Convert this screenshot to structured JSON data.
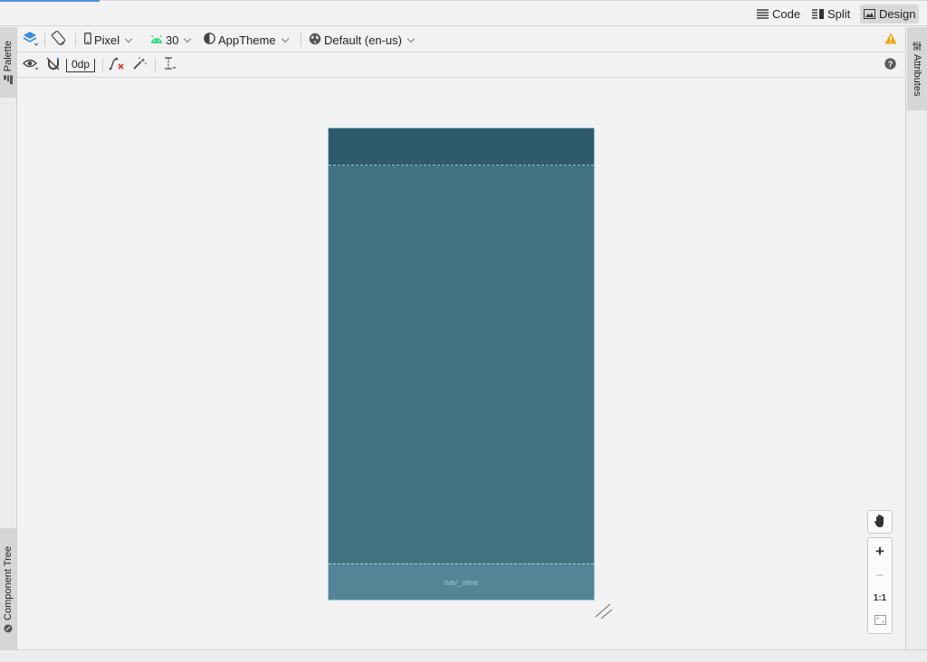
{
  "view_modes": {
    "code": "Code",
    "split": "Split",
    "design": "Design"
  },
  "left_panels": {
    "palette": "Palette",
    "component_tree": "Component Tree"
  },
  "right_panels": {
    "attributes": "Attributes"
  },
  "toolbar": {
    "device": "Pixel",
    "api_level": "30",
    "theme": "AppTheme",
    "locale": "Default (en-us)",
    "margin": "0dp"
  },
  "canvas": {
    "nav_view_label": "nav_view"
  },
  "zoom": {
    "zoom_in": "+",
    "zoom_out": "−",
    "actual_size": "1:1"
  },
  "colors": {
    "appbar": "#2e5a69",
    "content": "#437280",
    "nav_view": "#548597",
    "warning": "#f0a30a",
    "android_green": "#3ddc84",
    "accent": "#4a90e2"
  }
}
